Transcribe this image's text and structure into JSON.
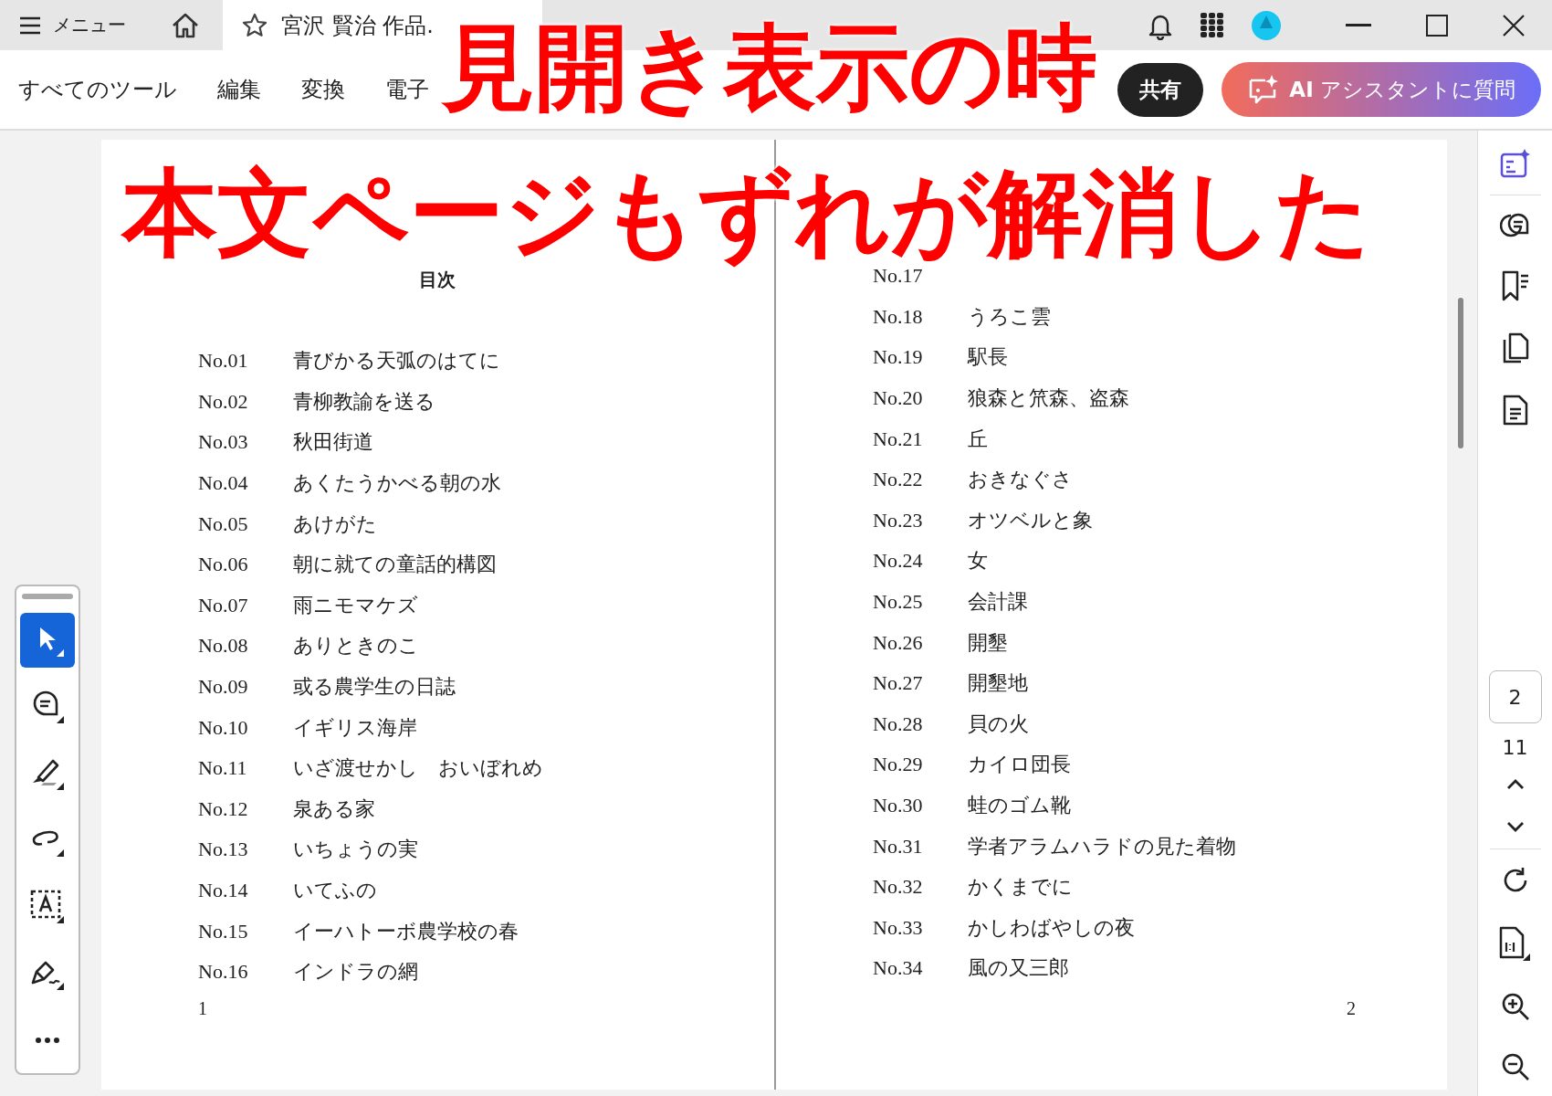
{
  "app_bar": {
    "menu_label": "メニュー",
    "tabs": [
      {
        "label": "宮沢 賢治 作品.",
        "selected": true
      }
    ]
  },
  "toolbar": {
    "items": [
      "すべてのツール",
      "編集",
      "変換",
      "電子"
    ],
    "share": "共有",
    "ai_button": "**AI** アシスタントに質問"
  },
  "document": {
    "left_page": {
      "heading": "目次",
      "page_number": "1",
      "entries": [
        {
          "number": "No.01",
          "title": "青びかる天弧のはてに"
        },
        {
          "number": "No.02",
          "title": "青柳教諭を送る"
        },
        {
          "number": "No.03",
          "title": "秋田街道"
        },
        {
          "number": "No.04",
          "title": "あくたうかべる朝の水"
        },
        {
          "number": "No.05",
          "title": "あけがた"
        },
        {
          "number": "No.06",
          "title": "朝に就ての童話的構図"
        },
        {
          "number": "No.07",
          "title": "雨ニモマケズ"
        },
        {
          "number": "No.08",
          "title": "ありときのこ"
        },
        {
          "number": "No.09",
          "title": "或る農学生の日誌"
        },
        {
          "number": "No.10",
          "title": "イギリス海岸"
        },
        {
          "number": "No.11",
          "title": "いざ渡せかし　おいぼれめ"
        },
        {
          "number": "No.12",
          "title": "泉ある家"
        },
        {
          "number": "No.13",
          "title": "いちょうの実"
        },
        {
          "number": "No.14",
          "title": "いてふの"
        },
        {
          "number": "No.15",
          "title": "イーハトーボ農学校の春"
        },
        {
          "number": "No.16",
          "title": "インドラの網"
        }
      ]
    },
    "right_page": {
      "page_number": "2",
      "entries": [
        {
          "number": "No.17"
        },
        {
          "number": "No.18",
          "title": "うろこ雲"
        },
        {
          "number": "No.19",
          "title": "駅長"
        },
        {
          "number": "No.20",
          "title": "狼森と笊森、盗森"
        },
        {
          "number": "No.21",
          "title": "丘"
        },
        {
          "number": "No.22",
          "title": "おきなぐさ"
        },
        {
          "number": "No.23",
          "title": "オツベルと象"
        },
        {
          "number": "No.24",
          "title": "女"
        },
        {
          "number": "No.25",
          "title": "会計課"
        },
        {
          "number": "No.26",
          "title": "開墾"
        },
        {
          "number": "No.27",
          "title": "開墾地"
        },
        {
          "number": "No.28",
          "title": "貝の火"
        },
        {
          "number": "No.29",
          "title": "カイロ団長"
        },
        {
          "number": "No.30",
          "title": "蛙のゴム靴"
        },
        {
          "number": "No.31",
          "title": "学者アラムハラドの見た着物"
        },
        {
          "number": "No.32",
          "title": "かくまでに"
        },
        {
          "number": "No.33",
          "title": "かしわばやしの夜"
        },
        {
          "number": "No.34",
          "title": "風の又三郎"
        }
      ]
    }
  },
  "tools": [
    {
      "kind": "select",
      "selected": true
    },
    {
      "kind": "comment",
      "selected": false
    },
    {
      "kind": "highlight",
      "selected": false
    },
    {
      "kind": "draw",
      "selected": false
    },
    {
      "kind": "text",
      "selected": false
    },
    {
      "kind": "sign",
      "selected": false
    },
    {
      "kind": "more",
      "selected": false
    }
  ],
  "page_nav": {
    "current": "2",
    "total": "11"
  },
  "overlay": {
    "lines": [
      "見開き表示の時",
      "本文ページもずれが解消した"
    ]
  }
}
